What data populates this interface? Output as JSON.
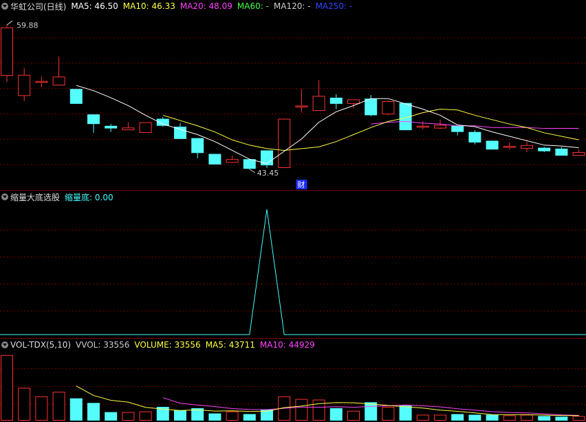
{
  "chart_data": [
    {
      "type": "candlestick",
      "pane": "main",
      "title": "华虹公司(日线)",
      "legend": [
        {
          "label": "MA5: 46.50",
          "color": "#ffffff"
        },
        {
          "label": "MA10: 46.33",
          "color": "#ffff44"
        },
        {
          "label": "MA20: 48.09",
          "color": "#ff44ff"
        },
        {
          "label": "MA60: -",
          "color": "#44ff44"
        },
        {
          "label": "MA120: -",
          "color": "#cccccc"
        },
        {
          "label": "MA250: -",
          "color": "#3344ff"
        }
      ],
      "high_label": "59.88",
      "low_label": "43.45",
      "marker": "财",
      "ylim": [
        42.5,
        61
      ],
      "candles": [
        {
          "o": 54.1,
          "c": 59.6,
          "h": 59.88,
          "l": 53.4
        },
        {
          "o": 51.8,
          "c": 54.2,
          "h": 55.0,
          "l": 51.2
        },
        {
          "o": 53.3,
          "c": 53.5,
          "h": 54.0,
          "l": 52.8
        },
        {
          "o": 53.0,
          "c": 54.0,
          "h": 56.3,
          "l": 53.0
        },
        {
          "o": 52.6,
          "c": 50.9,
          "h": 52.6,
          "l": 50.9
        },
        {
          "o": 49.7,
          "c": 48.6,
          "h": 49.7,
          "l": 47.6
        },
        {
          "o": 48.4,
          "c": 48.1,
          "h": 48.6,
          "l": 47.7
        },
        {
          "o": 47.9,
          "c": 48.2,
          "h": 48.8,
          "l": 47.9
        },
        {
          "o": 47.6,
          "c": 48.8,
          "h": 48.8,
          "l": 47.6
        },
        {
          "o": 49.2,
          "c": 48.4,
          "h": 49.4,
          "l": 48.3
        },
        {
          "o": 48.3,
          "c": 46.9,
          "h": 48.7,
          "l": 46.9
        },
        {
          "o": 47.0,
          "c": 45.3,
          "h": 47.0,
          "l": 44.7
        },
        {
          "o": 45.2,
          "c": 44.0,
          "h": 45.2,
          "l": 44.0
        },
        {
          "o": 44.2,
          "c": 44.6,
          "h": 45.0,
          "l": 44.2
        },
        {
          "o": 44.6,
          "c": 43.5,
          "h": 44.6,
          "l": 43.45
        },
        {
          "o": 45.6,
          "c": 43.9,
          "h": 45.6,
          "l": 43.6
        },
        {
          "o": 43.6,
          "c": 49.2,
          "h": 49.2,
          "l": 43.6
        },
        {
          "o": 50.5,
          "c": 50.7,
          "h": 52.6,
          "l": 49.9
        },
        {
          "o": 50.1,
          "c": 51.8,
          "h": 53.6,
          "l": 50.1
        },
        {
          "o": 51.6,
          "c": 50.9,
          "h": 52.0,
          "l": 50.3
        },
        {
          "o": 50.9,
          "c": 51.4,
          "h": 51.4,
          "l": 50.4
        },
        {
          "o": 51.5,
          "c": 49.6,
          "h": 51.9,
          "l": 49.5
        },
        {
          "o": 49.7,
          "c": 51.2,
          "h": 51.3,
          "l": 49.6
        },
        {
          "o": 51.0,
          "c": 47.9,
          "h": 51.0,
          "l": 47.9
        },
        {
          "o": 48.2,
          "c": 48.4,
          "h": 48.9,
          "l": 48.0
        },
        {
          "o": 48.1,
          "c": 48.5,
          "h": 49.1,
          "l": 48.0
        },
        {
          "o": 48.4,
          "c": 47.7,
          "h": 48.4,
          "l": 47.3
        },
        {
          "o": 47.7,
          "c": 46.5,
          "h": 47.9,
          "l": 46.3
        },
        {
          "o": 46.7,
          "c": 45.7,
          "h": 46.7,
          "l": 45.7
        },
        {
          "o": 45.9,
          "c": 46.1,
          "h": 46.5,
          "l": 45.7
        },
        {
          "o": 45.8,
          "c": 46.2,
          "h": 46.6,
          "l": 45.4
        },
        {
          "o": 45.9,
          "c": 45.5,
          "h": 46.0,
          "l": 45.4
        },
        {
          "o": 45.8,
          "c": 45.0,
          "h": 46.0,
          "l": 45.0
        },
        {
          "o": 45.0,
          "c": 45.4,
          "h": 45.7,
          "l": 45.0
        }
      ],
      "ma5": [
        null,
        null,
        null,
        null,
        53.0,
        52.4,
        51.6,
        50.7,
        49.6,
        48.6,
        48.0,
        47.4,
        46.6,
        45.6,
        44.6,
        44.1,
        45.5,
        46.9,
        48.8,
        50.0,
        50.7,
        51.5,
        51.5,
        50.9,
        50.3,
        49.6,
        48.5,
        48.3,
        47.7,
        47.2,
        46.7,
        46.2,
        46.1,
        45.9
      ],
      "ma10": [
        null,
        null,
        null,
        null,
        null,
        null,
        null,
        null,
        null,
        49.6,
        49.0,
        48.4,
        47.7,
        46.8,
        46.2,
        45.8,
        45.6,
        45.8,
        46.0,
        46.6,
        47.4,
        48.2,
        48.9,
        49.3,
        49.9,
        50.3,
        50.2,
        49.6,
        49.1,
        48.6,
        48.2,
        47.6,
        47.2,
        46.8
      ],
      "ma20": [
        null,
        null,
        null,
        null,
        null,
        null,
        null,
        null,
        null,
        null,
        null,
        null,
        null,
        null,
        null,
        null,
        null,
        null,
        null,
        null,
        null,
        48.6,
        48.8,
        48.9,
        48.7,
        48.6,
        48.4,
        48.4,
        48.2,
        48.2,
        48.2,
        48.1,
        48.1,
        48.1
      ]
    },
    {
      "type": "line",
      "pane": "indicator",
      "title": "缩量大底选股",
      "legend": [
        {
          "label": "缩量底: 0.00",
          "color": "#44ffff"
        }
      ],
      "ylim": [
        0,
        1.05
      ],
      "values": [
        0,
        0,
        0,
        0,
        0,
        0,
        0,
        0,
        0,
        0,
        0,
        0,
        0,
        0,
        0,
        1,
        0,
        0,
        0,
        0,
        0,
        0,
        0,
        0,
        0,
        0,
        0,
        0,
        0,
        0,
        0,
        0,
        0,
        0
      ]
    },
    {
      "type": "bar",
      "pane": "volume",
      "title": "VOL-TDX(5,10)",
      "legend": [
        {
          "label": "VVOL: 33556",
          "color": "#cccccc"
        },
        {
          "label": "VOLUME: 33556",
          "color": "#ffff44"
        },
        {
          "label": "MA5: 43711",
          "color": "#ffff44"
        },
        {
          "label": "MA10: 44929",
          "color": "#ff44ff"
        }
      ],
      "ylim": [
        0,
        105000
      ],
      "values": [
        100000,
        50000,
        37000,
        44000,
        34000,
        27000,
        13000,
        13000,
        14000,
        21000,
        16000,
        19000,
        11000,
        14000,
        10000,
        17000,
        37000,
        33000,
        32000,
        19000,
        15000,
        28000,
        21000,
        23000,
        9000,
        9000,
        10000,
        9000,
        9000,
        8000,
        9000,
        7000,
        6000,
        7000
      ],
      "ma5": [
        null,
        null,
        null,
        null,
        53000,
        38400,
        31000,
        28200,
        20200,
        17600,
        15400,
        16600,
        14600,
        15000,
        14000,
        14200,
        19800,
        22200,
        25800,
        27600,
        27200,
        25400,
        23000,
        21200,
        19200,
        16000,
        14200,
        11800,
        9200,
        9000,
        9000,
        8400,
        7800,
        7600
      ],
      "ma10": [
        null,
        null,
        null,
        null,
        null,
        null,
        null,
        null,
        null,
        35100,
        26500,
        23800,
        21400,
        18400,
        17000,
        16800,
        18800,
        20800,
        20400,
        21200,
        20400,
        21600,
        22600,
        23800,
        22600,
        21000,
        18100,
        16000,
        13700,
        12400,
        11800,
        10200,
        8800,
        8000
      ]
    }
  ]
}
